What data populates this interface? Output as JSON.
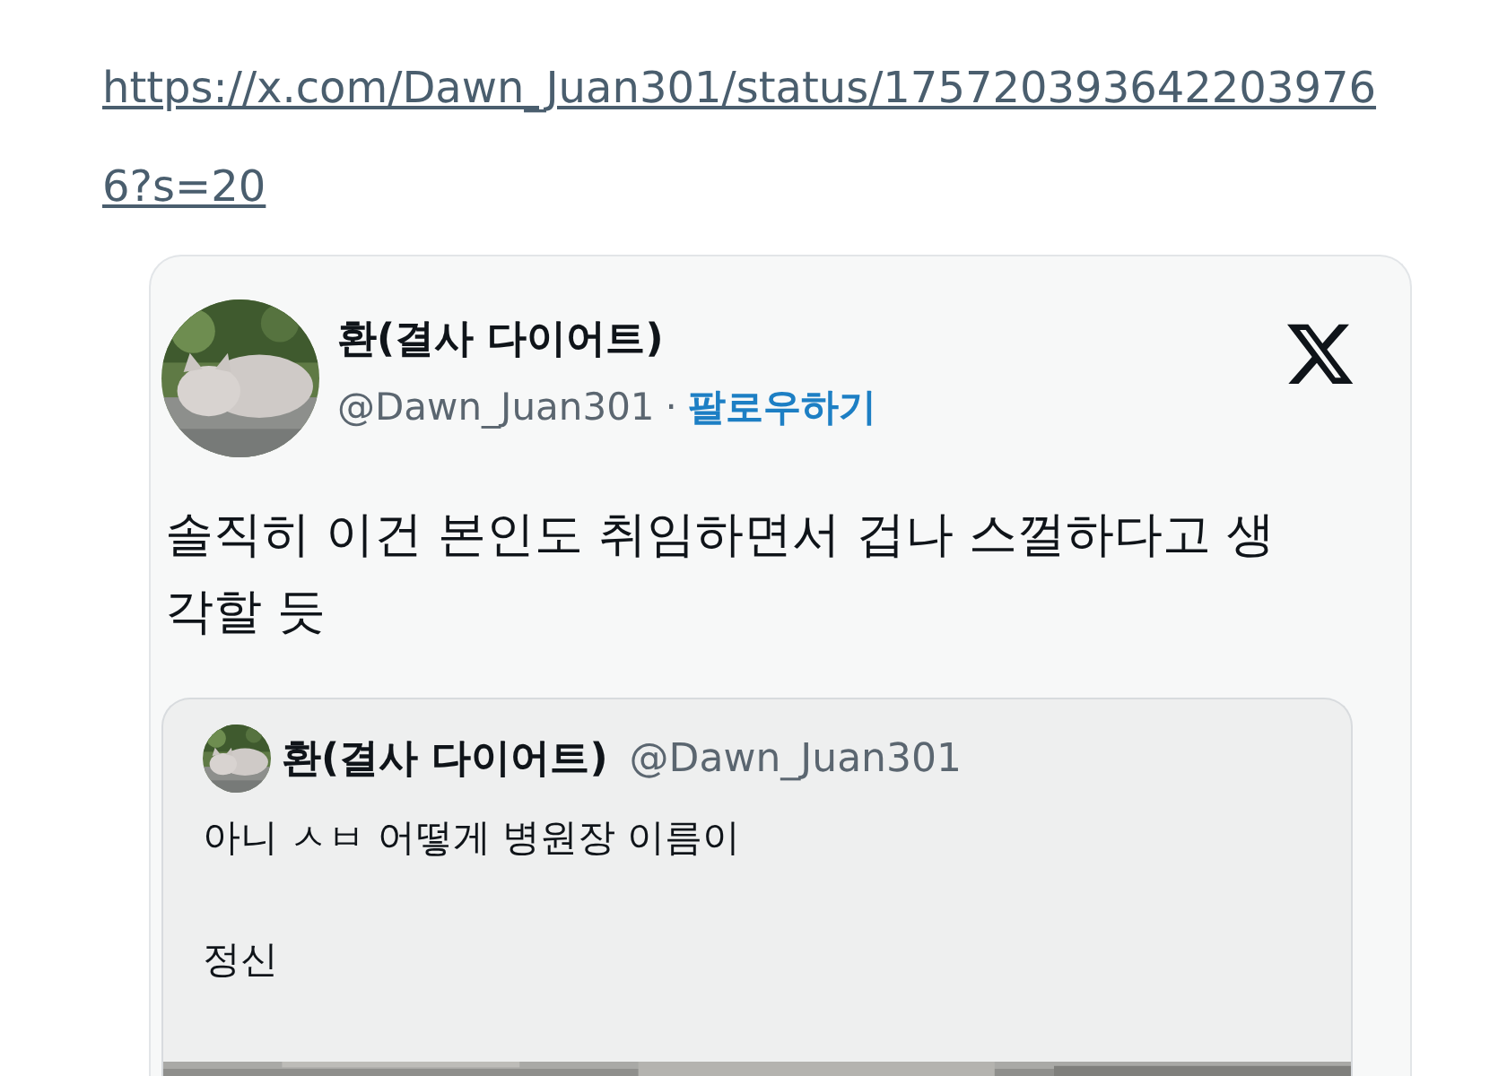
{
  "link": "https://x.com/Dawn_Juan301/status/1757203936422039766?s=20",
  "tweet": {
    "display_name": "환(결사 다이어트)",
    "handle": "@Dawn_Juan301",
    "separator": "·",
    "follow": "팔로우하기",
    "text": "솔직히 이건 본인도 취임하면서 겁나 스껄하다고 생각할 듯",
    "quote": {
      "display_name": "환(결사 다이어트)",
      "handle": "@Dawn_Juan301",
      "lines": [
        "아니 ㅅㅂ 어떻게 병원장 이름이",
        "정신"
      ]
    }
  }
}
